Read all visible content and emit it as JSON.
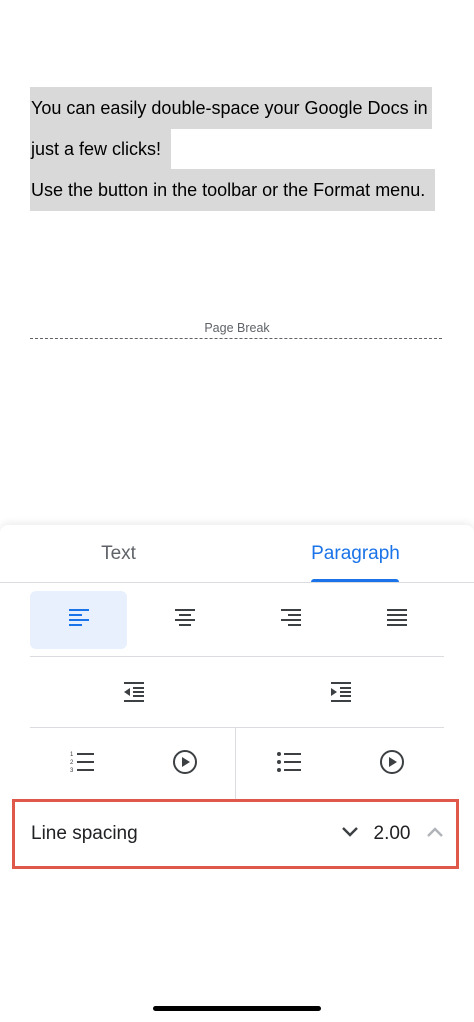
{
  "document": {
    "lines": [
      "You can easily double-space your Google Docs in",
      "just a few clicks!",
      "Use the button in the toolbar or the Format menu."
    ],
    "page_break_label": "Page Break"
  },
  "panel": {
    "tabs": [
      {
        "label": "Text",
        "selected": false
      },
      {
        "label": "Paragraph",
        "selected": true
      }
    ],
    "alignment": {
      "options": [
        "align-left-icon",
        "align-center-icon",
        "align-right-icon",
        "align-justify-icon"
      ],
      "selected": "align-left"
    },
    "indent": [
      "decrease-indent-icon",
      "increase-indent-icon"
    ],
    "lists": [
      "numbered-list-icon",
      "numbered-list-options-icon",
      "bulleted-list-icon",
      "bulleted-list-options-icon"
    ],
    "line_spacing": {
      "label": "Line spacing",
      "value": "2.00"
    }
  },
  "colors": {
    "accent": "#1a73e8",
    "highlight_box": "#e0584a",
    "selection": "#d9d9d9"
  }
}
